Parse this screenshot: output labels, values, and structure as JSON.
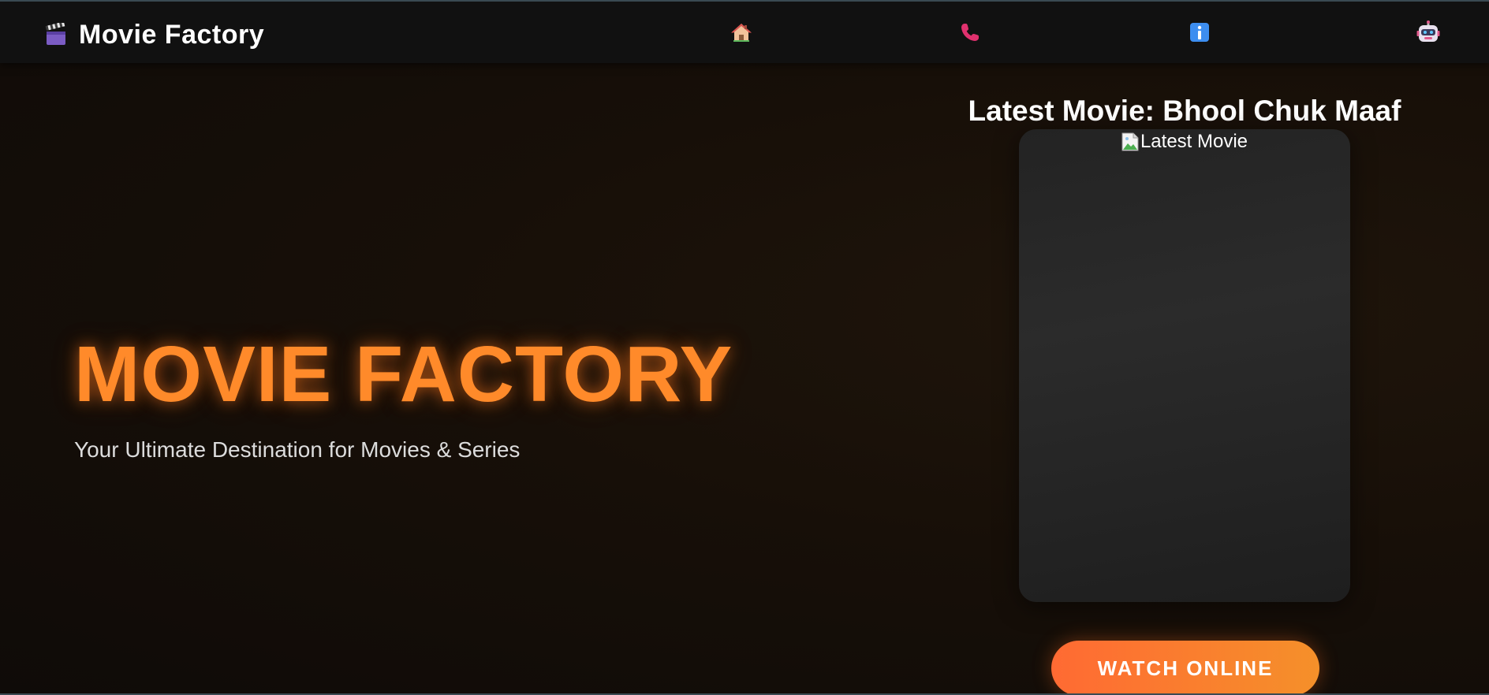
{
  "brand": {
    "icon": "clapperboard-icon",
    "name": "Movie Factory"
  },
  "nav": {
    "items": [
      {
        "icon": "home-icon",
        "label": ""
      },
      {
        "icon": "phone-icon",
        "label": ""
      },
      {
        "icon": "info-icon",
        "label": ""
      },
      {
        "icon": "robot-icon",
        "label": ""
      }
    ]
  },
  "hero": {
    "title": "MOVIE FACTORY",
    "subtitle": "Your Ultimate Destination for Movies & Series"
  },
  "latest": {
    "heading": "Latest Movie: Bhool Chuk Maaf",
    "poster_alt": "Latest Movie",
    "button_label": "WATCH ONLINE"
  },
  "colors": {
    "accent": "#ff8a2a",
    "button_start": "#ff6a33",
    "button_end": "#f5902a",
    "navbar_bg": "#111111"
  }
}
